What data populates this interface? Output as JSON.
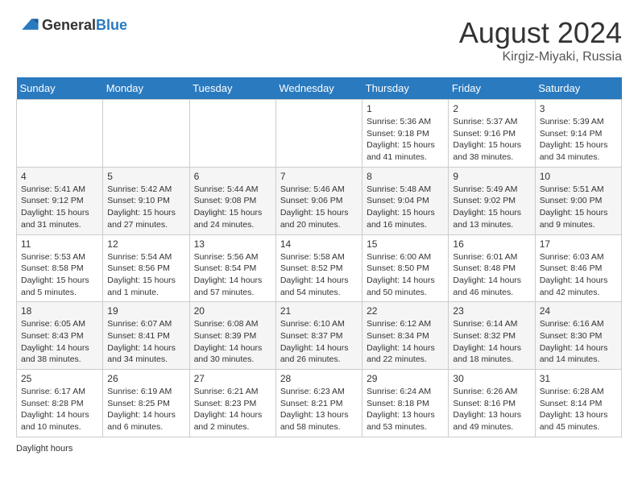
{
  "header": {
    "logo_general": "General",
    "logo_blue": "Blue",
    "month_year": "August 2024",
    "location": "Kirgiz-Miyaki, Russia"
  },
  "footer": {
    "daylight_label": "Daylight hours"
  },
  "weekdays": [
    "Sunday",
    "Monday",
    "Tuesday",
    "Wednesday",
    "Thursday",
    "Friday",
    "Saturday"
  ],
  "weeks": [
    [
      {
        "day": "",
        "info": ""
      },
      {
        "day": "",
        "info": ""
      },
      {
        "day": "",
        "info": ""
      },
      {
        "day": "",
        "info": ""
      },
      {
        "day": "1",
        "info": "Sunrise: 5:36 AM\nSunset: 9:18 PM\nDaylight: 15 hours\nand 41 minutes."
      },
      {
        "day": "2",
        "info": "Sunrise: 5:37 AM\nSunset: 9:16 PM\nDaylight: 15 hours\nand 38 minutes."
      },
      {
        "day": "3",
        "info": "Sunrise: 5:39 AM\nSunset: 9:14 PM\nDaylight: 15 hours\nand 34 minutes."
      }
    ],
    [
      {
        "day": "4",
        "info": "Sunrise: 5:41 AM\nSunset: 9:12 PM\nDaylight: 15 hours\nand 31 minutes."
      },
      {
        "day": "5",
        "info": "Sunrise: 5:42 AM\nSunset: 9:10 PM\nDaylight: 15 hours\nand 27 minutes."
      },
      {
        "day": "6",
        "info": "Sunrise: 5:44 AM\nSunset: 9:08 PM\nDaylight: 15 hours\nand 24 minutes."
      },
      {
        "day": "7",
        "info": "Sunrise: 5:46 AM\nSunset: 9:06 PM\nDaylight: 15 hours\nand 20 minutes."
      },
      {
        "day": "8",
        "info": "Sunrise: 5:48 AM\nSunset: 9:04 PM\nDaylight: 15 hours\nand 16 minutes."
      },
      {
        "day": "9",
        "info": "Sunrise: 5:49 AM\nSunset: 9:02 PM\nDaylight: 15 hours\nand 13 minutes."
      },
      {
        "day": "10",
        "info": "Sunrise: 5:51 AM\nSunset: 9:00 PM\nDaylight: 15 hours\nand 9 minutes."
      }
    ],
    [
      {
        "day": "11",
        "info": "Sunrise: 5:53 AM\nSunset: 8:58 PM\nDaylight: 15 hours\nand 5 minutes."
      },
      {
        "day": "12",
        "info": "Sunrise: 5:54 AM\nSunset: 8:56 PM\nDaylight: 15 hours\nand 1 minute."
      },
      {
        "day": "13",
        "info": "Sunrise: 5:56 AM\nSunset: 8:54 PM\nDaylight: 14 hours\nand 57 minutes."
      },
      {
        "day": "14",
        "info": "Sunrise: 5:58 AM\nSunset: 8:52 PM\nDaylight: 14 hours\nand 54 minutes."
      },
      {
        "day": "15",
        "info": "Sunrise: 6:00 AM\nSunset: 8:50 PM\nDaylight: 14 hours\nand 50 minutes."
      },
      {
        "day": "16",
        "info": "Sunrise: 6:01 AM\nSunset: 8:48 PM\nDaylight: 14 hours\nand 46 minutes."
      },
      {
        "day": "17",
        "info": "Sunrise: 6:03 AM\nSunset: 8:46 PM\nDaylight: 14 hours\nand 42 minutes."
      }
    ],
    [
      {
        "day": "18",
        "info": "Sunrise: 6:05 AM\nSunset: 8:43 PM\nDaylight: 14 hours\nand 38 minutes."
      },
      {
        "day": "19",
        "info": "Sunrise: 6:07 AM\nSunset: 8:41 PM\nDaylight: 14 hours\nand 34 minutes."
      },
      {
        "day": "20",
        "info": "Sunrise: 6:08 AM\nSunset: 8:39 PM\nDaylight: 14 hours\nand 30 minutes."
      },
      {
        "day": "21",
        "info": "Sunrise: 6:10 AM\nSunset: 8:37 PM\nDaylight: 14 hours\nand 26 minutes."
      },
      {
        "day": "22",
        "info": "Sunrise: 6:12 AM\nSunset: 8:34 PM\nDaylight: 14 hours\nand 22 minutes."
      },
      {
        "day": "23",
        "info": "Sunrise: 6:14 AM\nSunset: 8:32 PM\nDaylight: 14 hours\nand 18 minutes."
      },
      {
        "day": "24",
        "info": "Sunrise: 6:16 AM\nSunset: 8:30 PM\nDaylight: 14 hours\nand 14 minutes."
      }
    ],
    [
      {
        "day": "25",
        "info": "Sunrise: 6:17 AM\nSunset: 8:28 PM\nDaylight: 14 hours\nand 10 minutes."
      },
      {
        "day": "26",
        "info": "Sunrise: 6:19 AM\nSunset: 8:25 PM\nDaylight: 14 hours\nand 6 minutes."
      },
      {
        "day": "27",
        "info": "Sunrise: 6:21 AM\nSunset: 8:23 PM\nDaylight: 14 hours\nand 2 minutes."
      },
      {
        "day": "28",
        "info": "Sunrise: 6:23 AM\nSunset: 8:21 PM\nDaylight: 13 hours\nand 58 minutes."
      },
      {
        "day": "29",
        "info": "Sunrise: 6:24 AM\nSunset: 8:18 PM\nDaylight: 13 hours\nand 53 minutes."
      },
      {
        "day": "30",
        "info": "Sunrise: 6:26 AM\nSunset: 8:16 PM\nDaylight: 13 hours\nand 49 minutes."
      },
      {
        "day": "31",
        "info": "Sunrise: 6:28 AM\nSunset: 8:14 PM\nDaylight: 13 hours\nand 45 minutes."
      }
    ]
  ]
}
